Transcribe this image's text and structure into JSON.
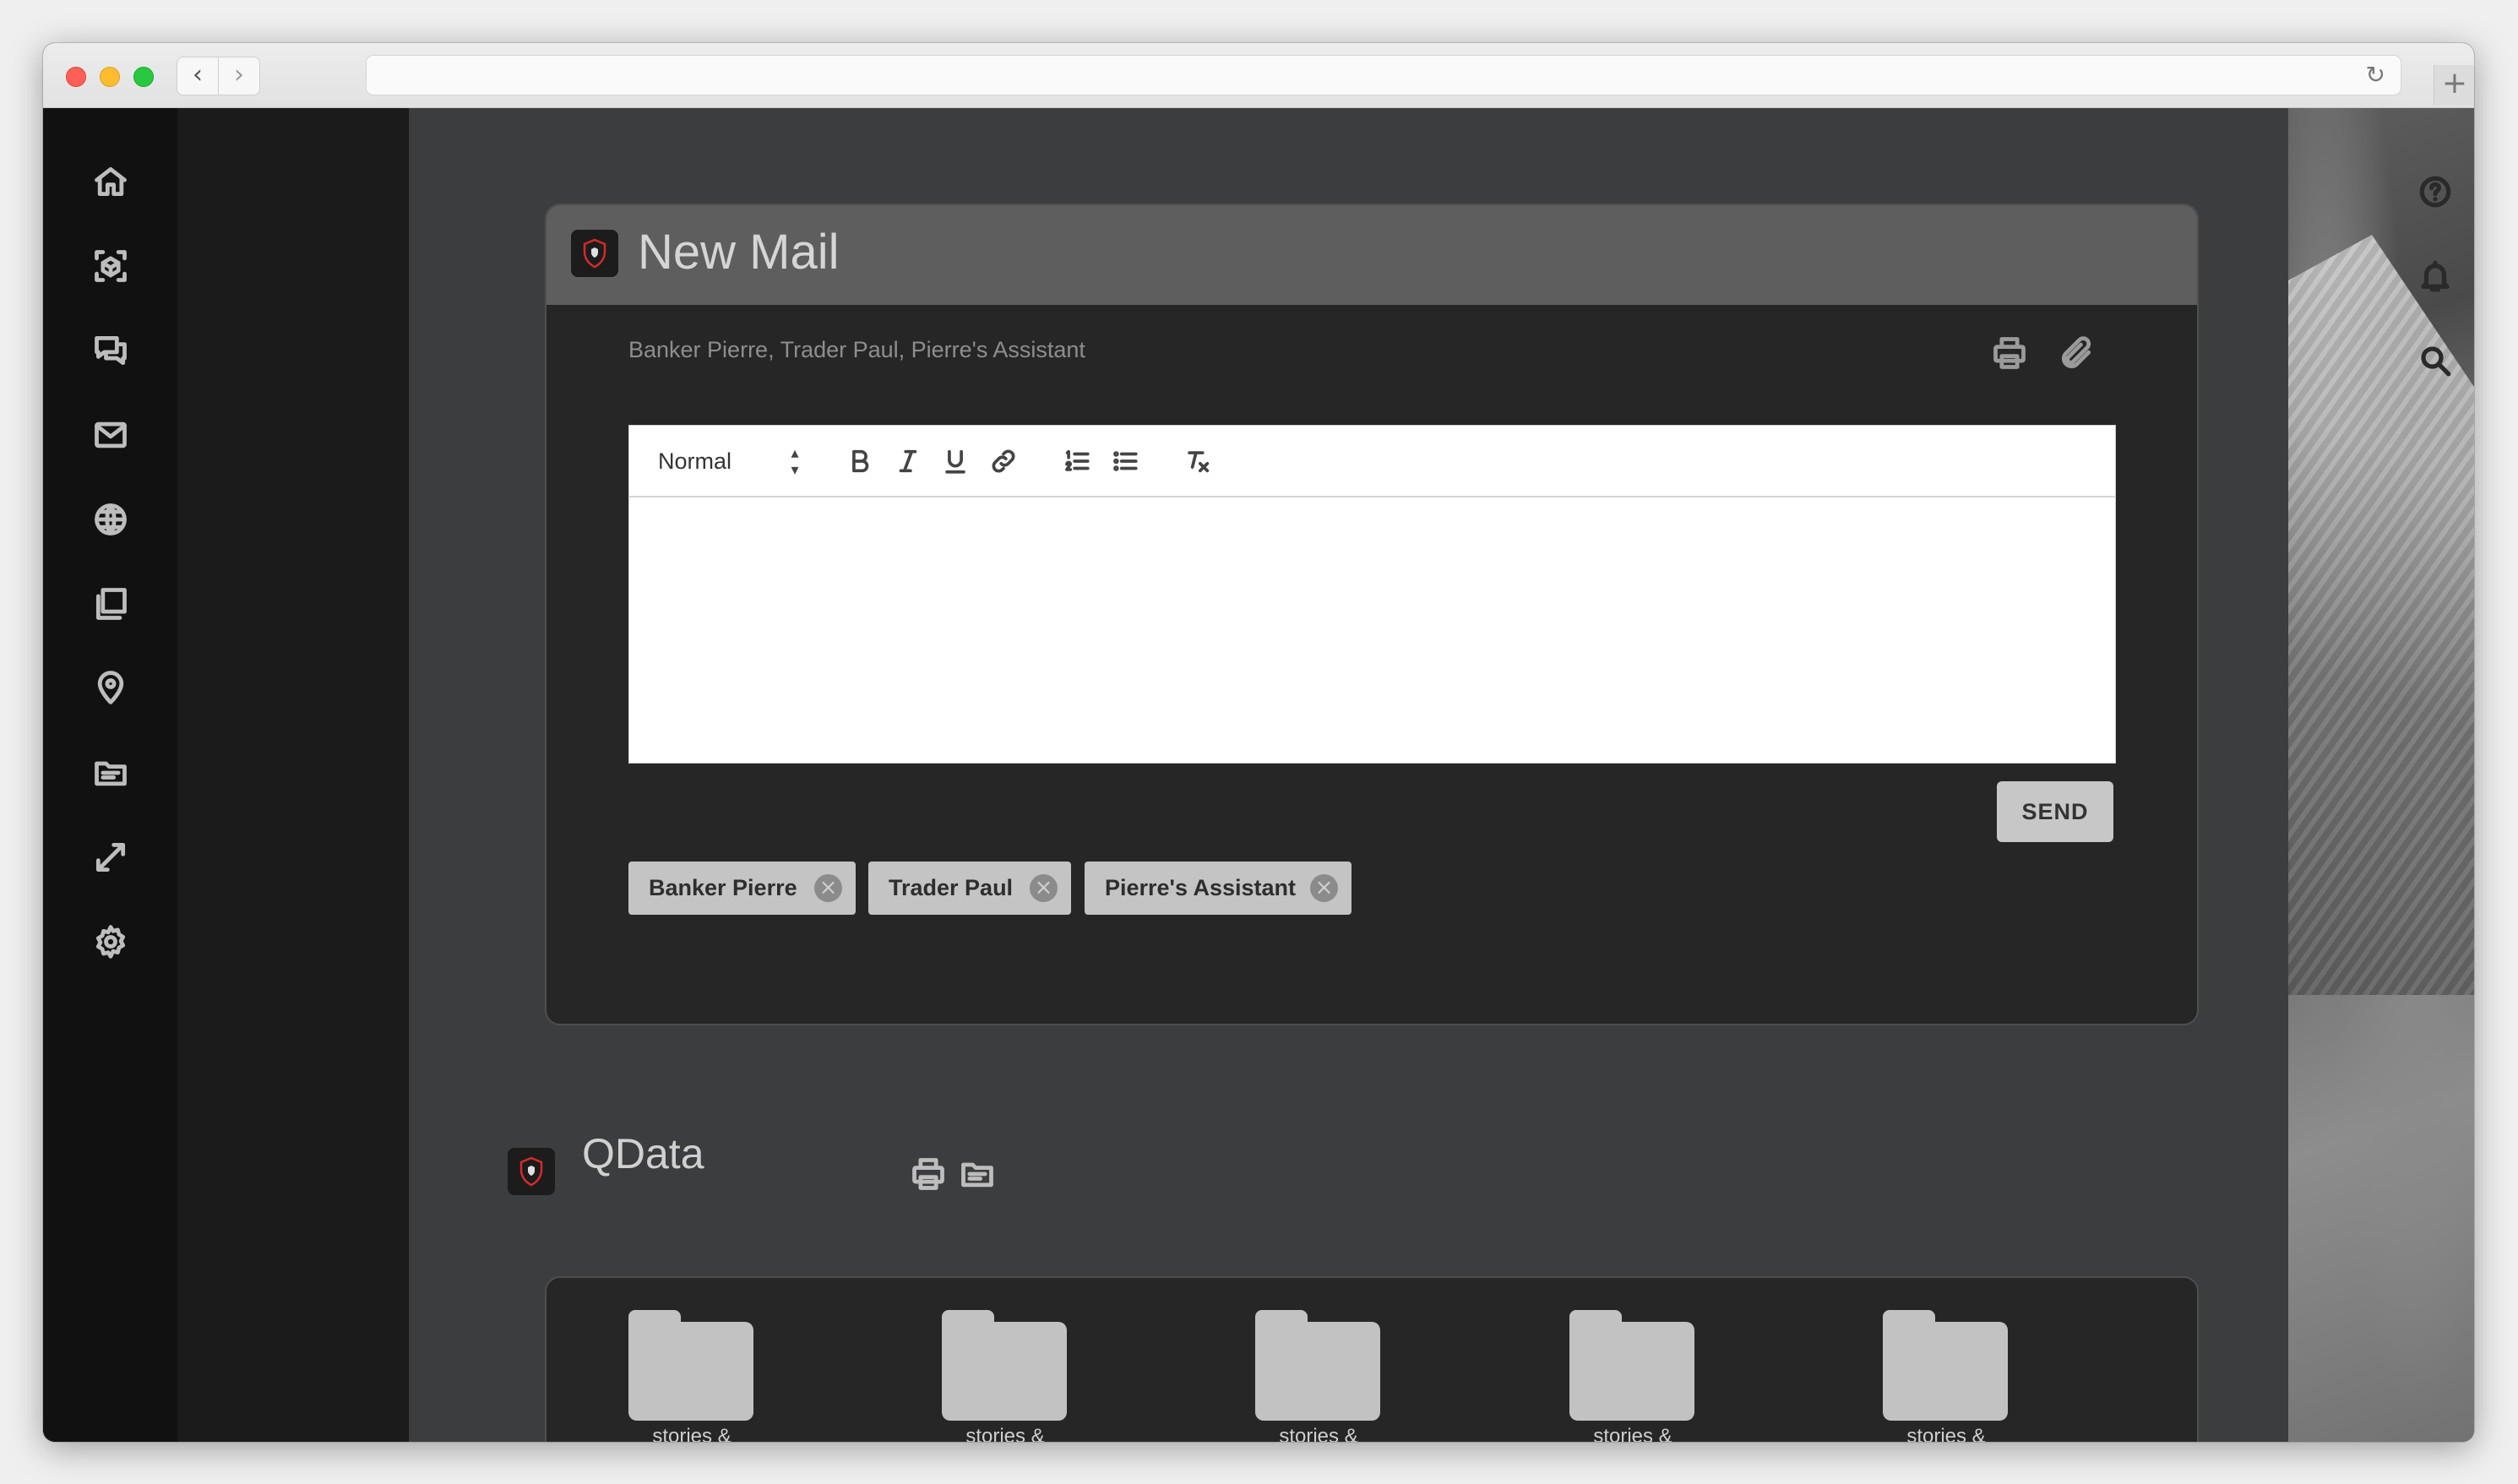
{
  "browser": {
    "url": "",
    "back_icon": "chevron-left-icon",
    "forward_icon": "chevron-right-icon",
    "reload_icon": "reload-icon",
    "new_tab_icon": "plus-icon"
  },
  "left_nav": {
    "items": [
      {
        "id": "home",
        "icon": "home-icon"
      },
      {
        "id": "cube",
        "icon": "cube-icon"
      },
      {
        "id": "chat",
        "icon": "chat-icon"
      },
      {
        "id": "mail",
        "icon": "mail-icon"
      },
      {
        "id": "globe",
        "icon": "globe-icon"
      },
      {
        "id": "copy",
        "icon": "copy-icon"
      },
      {
        "id": "location",
        "icon": "location-pin-icon"
      },
      {
        "id": "folder",
        "icon": "folder-icon"
      },
      {
        "id": "expand",
        "icon": "expand-icon"
      },
      {
        "id": "settings",
        "icon": "gear-icon"
      }
    ]
  },
  "right_nav": {
    "items": [
      {
        "id": "help",
        "icon": "help-icon"
      },
      {
        "id": "notifications",
        "icon": "bell-icon"
      },
      {
        "id": "search",
        "icon": "search-icon"
      }
    ]
  },
  "mail": {
    "title": "New Mail",
    "recipients_text": "Banker Pierre, Trader Paul, Pierre's Assistant",
    "print_icon": "print-icon",
    "attach_icon": "paperclip-icon",
    "editor": {
      "format_value": "Normal",
      "body_text": "",
      "toolbar": [
        "bold",
        "italic",
        "underline",
        "link",
        "ordered-list",
        "bullet-list",
        "clear-format"
      ]
    },
    "send_label": "SEND",
    "chips": [
      {
        "label": "Banker Pierre"
      },
      {
        "label": "Trader Paul"
      },
      {
        "label": "Pierre's Assistant"
      }
    ]
  },
  "qdata": {
    "title": "QData",
    "folders": [
      {
        "label": "stories & jokes"
      },
      {
        "label": "stories & jokes"
      },
      {
        "label": "stories & jokes"
      },
      {
        "label": "stories & jokes"
      },
      {
        "label": "stories & jokes"
      }
    ]
  },
  "colors": {
    "rail": "#111111",
    "main_bg": "#3c3d3e",
    "card_bg": "#262626",
    "header_bg": "#5e5e5e",
    "chip_bg": "#c4c4c4",
    "logo_accent": "#d42b2b"
  }
}
